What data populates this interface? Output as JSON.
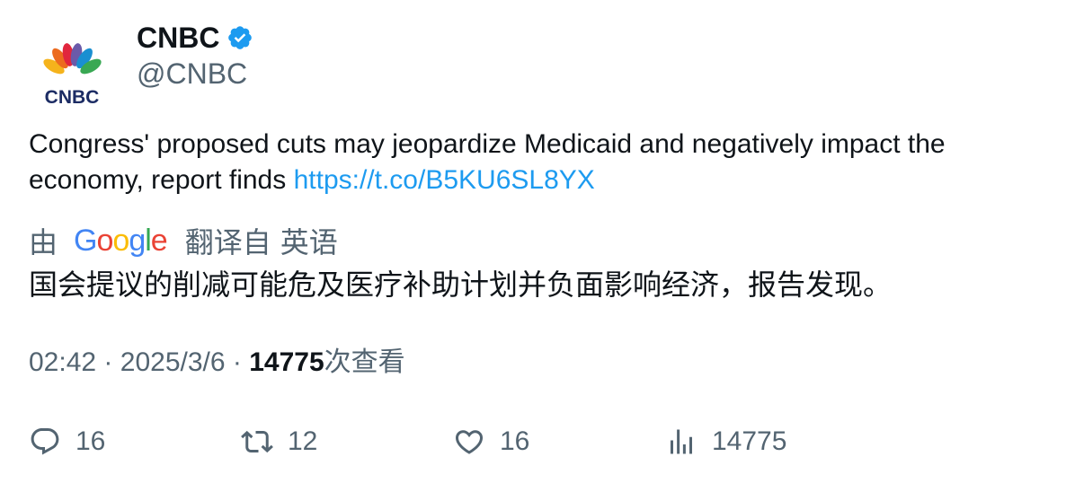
{
  "author": {
    "display_name": "CNBC",
    "handle": "@CNBC",
    "avatar_text": "CNBC",
    "verified": true
  },
  "tweet": {
    "text": "Congress' proposed cuts may jeopardize Medicaid and negatively impact the economy, report finds ",
    "link": "https://t.co/B5KU6SL8YX"
  },
  "translation": {
    "by_label": "由",
    "provider": "Google",
    "translated_from_label": "翻译自",
    "source_language": "英语",
    "text": "国会提议的削减可能危及医疗补助计划并负面影响经济，报告发现。"
  },
  "meta": {
    "time": "02:42",
    "separator": "·",
    "date": "2025/3/6",
    "views_count": "14775",
    "views_label": "次查看"
  },
  "actions": {
    "replies": "16",
    "retweets": "12",
    "likes": "16",
    "views": "14775"
  },
  "colors": {
    "link": "#1d9bf0",
    "secondary_text": "#536471",
    "primary_text": "#0f1419",
    "verified_badge": "#1d9bf0"
  }
}
